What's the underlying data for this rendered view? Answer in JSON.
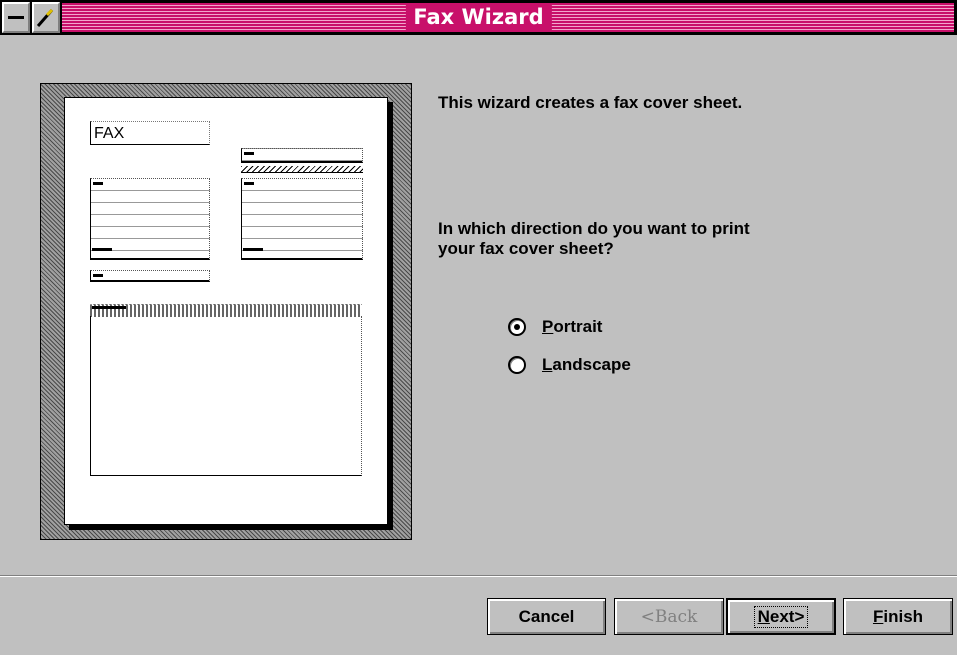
{
  "window": {
    "title": "Fax Wizard"
  },
  "preview": {
    "fax_label": "FAX"
  },
  "content": {
    "intro": "This wizard creates a fax cover sheet.",
    "question_line1": "In which direction do you want to print",
    "question_line2": "your fax cover sheet?",
    "orientation": {
      "selected": "Portrait",
      "options": [
        {
          "label": "Portrait",
          "mnemonic": "P",
          "rest": "ortrait"
        },
        {
          "label": "Landscape",
          "mnemonic": "L",
          "rest": "andscape"
        }
      ]
    }
  },
  "buttons": {
    "cancel": "Cancel",
    "back": "<Back",
    "next_mn": "N",
    "next_rest": "ext>",
    "finish_mn": "F",
    "finish_rest": "inish"
  }
}
